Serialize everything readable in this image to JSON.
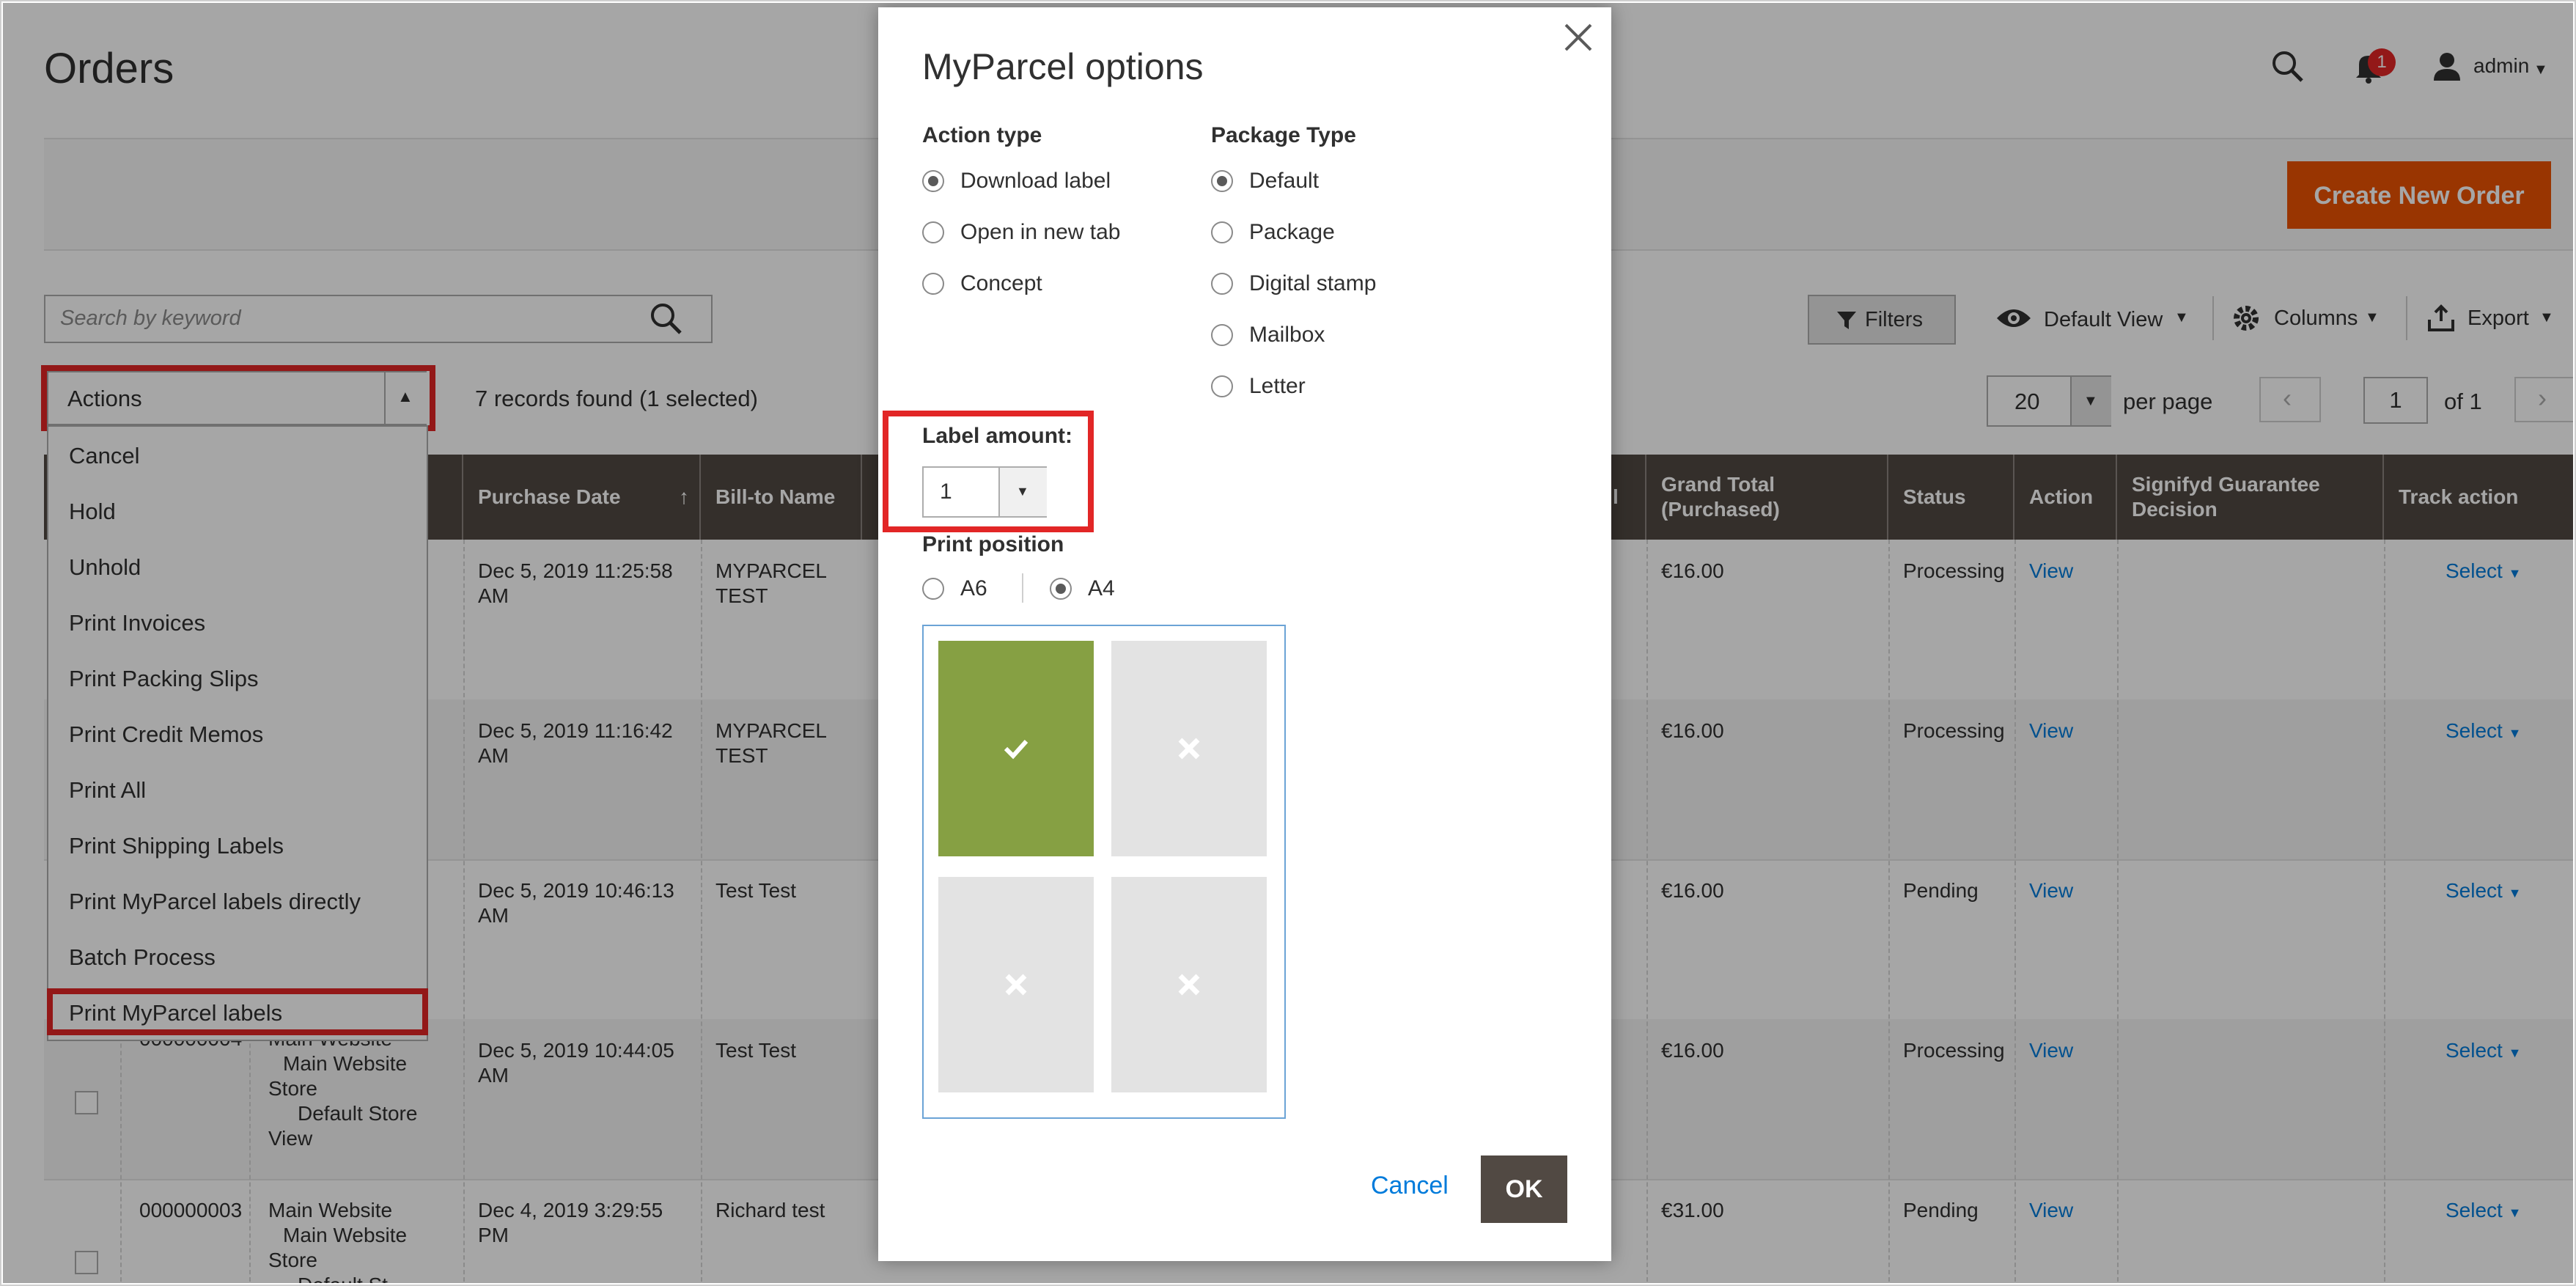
{
  "header": {
    "title": "Orders",
    "notification_count": "1",
    "username": "admin",
    "create_button": "Create New Order"
  },
  "toolbar": {
    "search_placeholder": "Search by keyword",
    "filters": "Filters",
    "default_view": "Default View",
    "columns": "Columns",
    "export": "Export"
  },
  "actions": {
    "label": "Actions",
    "records": "7 records found (1 selected)",
    "items": [
      "Cancel",
      "Hold",
      "Unhold",
      "Print Invoices",
      "Print Packing Slips",
      "Print Credit Memos",
      "Print All",
      "Print Shipping Labels",
      "Print MyParcel labels directly",
      "Batch Process",
      "Print MyParcel labels"
    ]
  },
  "paging": {
    "per_page_value": "20",
    "per_page_label": "per page",
    "current_page": "1",
    "of_pages": "of 1"
  },
  "table": {
    "headers": {
      "purchase_date": "Purchase Date",
      "bill_to": "Bill-to Name",
      "grand_total": "Grand Total (Purchased)",
      "status": "Status",
      "action": "Action",
      "signifyd": "Signifyd Guarantee Decision",
      "track": "Track action",
      "partial_l": "l"
    },
    "rows": [
      {
        "id": "",
        "website": "",
        "date": "Dec 5, 2019 11:25:58 AM",
        "bill": "MYPARCEL TEST",
        "total": "€16.00",
        "status": "Processing",
        "action": "View",
        "track": "Select"
      },
      {
        "id": "",
        "website": "",
        "date": "Dec 5, 2019 11:16:42 AM",
        "bill": "MYPARCEL TEST",
        "total": "€16.00",
        "status": "Processing",
        "action": "View",
        "track": "Select"
      },
      {
        "id": "",
        "website": "",
        "date": "Dec 5, 2019 10:46:13 AM",
        "bill": "Test Test",
        "total": "€16.00",
        "status": "Pending",
        "action": "View",
        "track": "Select"
      },
      {
        "id": "000000004",
        "website": "Main Website",
        "store": "Main Website Store",
        "view": "Default Store View",
        "date": "Dec 5, 2019 10:44:05 AM",
        "bill": "Test Test",
        "total": "€16.00",
        "status": "Processing",
        "action": "View",
        "track": "Select"
      },
      {
        "id": "000000003",
        "website": "Main Website",
        "store": "Main Website Store",
        "view": "Default St...",
        "date": "Dec 4, 2019 3:29:55 PM",
        "bill": "Richard test",
        "total": "€31.00",
        "status": "Pending",
        "action": "View",
        "track": "Select"
      }
    ]
  },
  "modal": {
    "title": "MyParcel options",
    "action_type_label": "Action type",
    "action_types": [
      {
        "label": "Download label",
        "selected": true
      },
      {
        "label": "Open in new tab",
        "selected": false
      },
      {
        "label": "Concept",
        "selected": false
      }
    ],
    "package_type_label": "Package Type",
    "package_types": [
      {
        "label": "Default",
        "selected": true
      },
      {
        "label": "Package",
        "selected": false
      },
      {
        "label": "Digital stamp",
        "selected": false
      },
      {
        "label": "Mailbox",
        "selected": false
      },
      {
        "label": "Letter",
        "selected": false
      }
    ],
    "label_amount_label": "Label amount:",
    "label_amount_value": "1",
    "print_position_label": "Print position",
    "print_positions": [
      {
        "label": "A6",
        "selected": false
      },
      {
        "label": "A4",
        "selected": true
      }
    ],
    "positions_selected": [
      true,
      false,
      false,
      false
    ],
    "cancel": "Cancel",
    "ok": "OK"
  },
  "colors": {
    "accent": "#eb5202",
    "header": "#514943",
    "link": "#007bdb",
    "highlight": "#e22626",
    "selected_cell": "#86a043"
  }
}
